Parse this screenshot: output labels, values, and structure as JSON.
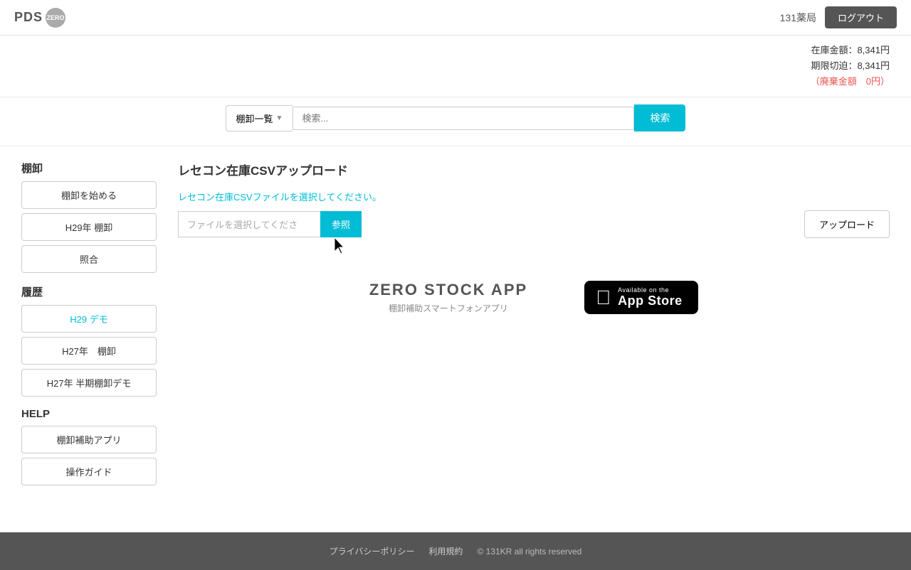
{
  "header": {
    "logo_text": "PDS",
    "logo_badge": "ZERO",
    "pharmacy": "131薬局",
    "logout_label": "ログアウト"
  },
  "info": {
    "stock_label": "在庫金額：8,341円",
    "expiry_label": "期限切迫：8,341円",
    "waste_label": "（廃棄金額　0円）"
  },
  "search": {
    "dropdown_label": "棚卸一覧",
    "input_placeholder": "検索...",
    "button_label": "検索"
  },
  "sidebar": {
    "section1_title": "棚卸",
    "btn_start": "棚卸を始める",
    "btn_h29": "H29年 棚卸",
    "btn_collate": "照合",
    "section2_title": "履歴",
    "btn_h29demo": "H29 デモ",
    "btn_h27": "H27年　棚卸",
    "btn_h27half": "H27年 半期棚卸デモ",
    "section3_title": "HELP",
    "btn_assist": "棚卸補助アプリ",
    "btn_guide": "操作ガイド"
  },
  "content": {
    "title": "レセコン在庫CSVアップロード",
    "upload_label": "レセコン在庫CSVファイルを選択してください。",
    "file_placeholder": "ファイルを選択してくださ",
    "browse_btn": "参照",
    "upload_btn": "アップロード"
  },
  "app_promo": {
    "title": "ZERO STOCK APP",
    "subtitle": "棚卸補助スマートフォンアプリ",
    "available": "Available on the",
    "store_name": "App Store"
  },
  "footer": {
    "privacy": "プライバシーポリシー",
    "terms": "利用規約",
    "copyright": "© 131KR all rights reserved"
  }
}
